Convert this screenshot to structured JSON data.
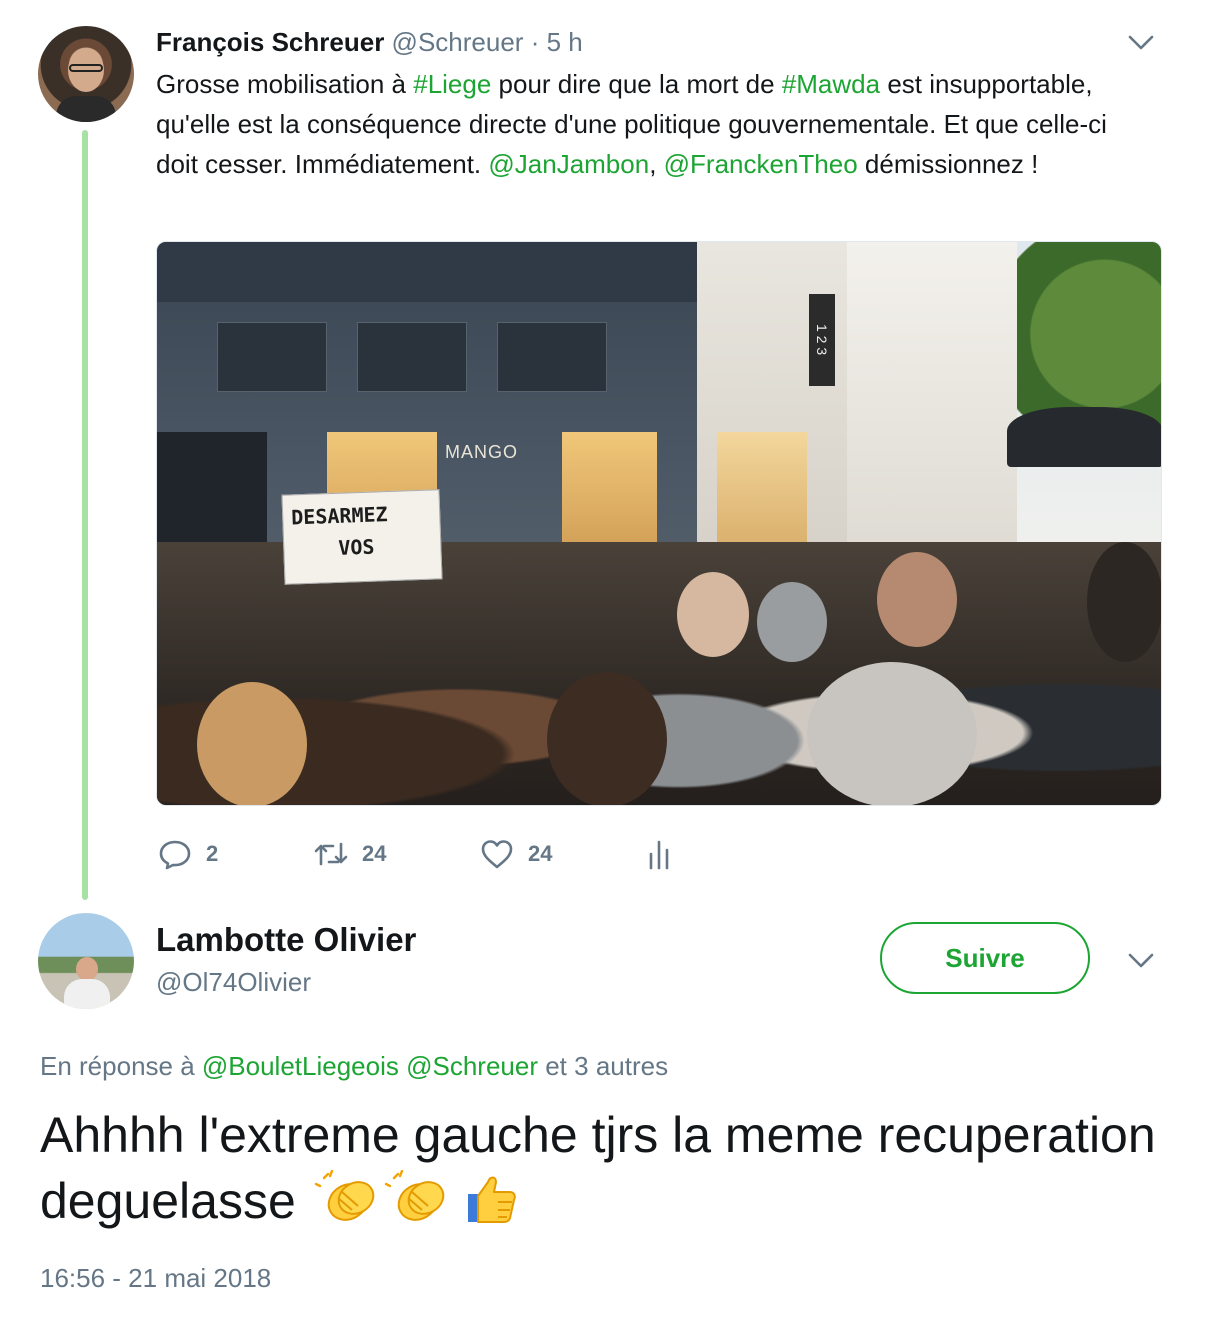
{
  "parent_tweet": {
    "author_name": "François Schreuer",
    "author_handle": "@Schreuer",
    "time": "· 5 h",
    "text": {
      "part1": "Grosse mobilisation à ",
      "tag_liege": "#Liege",
      "part2": " pour dire que la mort de ",
      "tag_mawda": "#Mawda",
      "part3": " est insupportable, qu'elle est la conséquence directe d'une politique gouvernementale. Et que celle-ci doit cesser. Immédiatement. ",
      "mention_jambon": "@JanJambon",
      "part4": ", ",
      "mention_francken": "@FranckenTheo",
      "part5": " démissionnez !"
    },
    "photo": {
      "shop_sign": "MANGO",
      "store_sign": "1 2 3",
      "banner_line1": "DESARMEZ",
      "banner_line2": "VOS"
    },
    "actions": {
      "replies": "2",
      "retweets": "24",
      "likes": "24"
    },
    "icons": [
      "reply-icon",
      "retweet-icon",
      "like-icon",
      "stats-icon",
      "chevron-down-icon"
    ]
  },
  "reply_tweet": {
    "author_name": "Lambotte Olivier",
    "author_handle": "@Ol74Olivier",
    "follow_label": "Suivre",
    "reply_to": {
      "prefix": "En réponse à ",
      "mention1": "@BouletLiegeois",
      "mention2": "@Schreuer",
      "suffix": " et 3 autres"
    },
    "text": "Ahhhh l'extreme gauche tjrs la meme recuperation deguelasse",
    "emojis": [
      "clapping-hands-emoji",
      "clapping-hands-emoji",
      "thumbs-up-emoji"
    ],
    "timestamp": "16:56 - 21 mai 2018"
  },
  "colors": {
    "accent": "#1da534",
    "thread_line": "#a8e1a4",
    "secondary_text": "#657786",
    "primary_text": "#14171a"
  }
}
